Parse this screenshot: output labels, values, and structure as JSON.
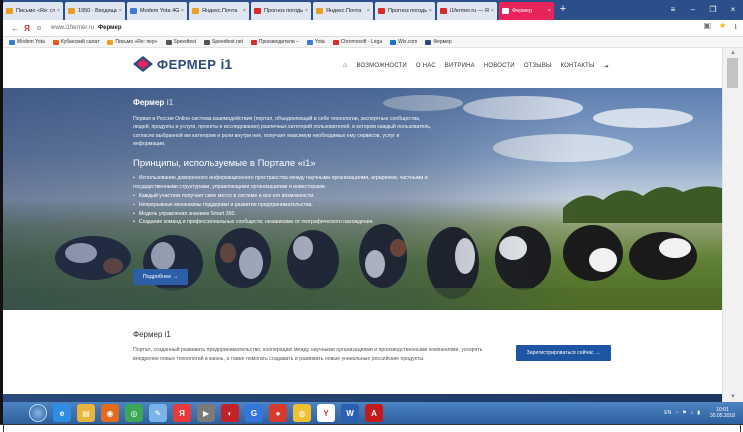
{
  "tabs": [
    {
      "label": "Письмо «Re: стат",
      "color": "#e8a020"
    },
    {
      "label": "1950 · Входящие –",
      "color": "#e8a020"
    },
    {
      "label": "Modem Yota 4G LTE",
      "color": "#3a7ad8"
    },
    {
      "label": "Яндекс.Почта",
      "color": "#e8a020"
    },
    {
      "label": "Прогноз погоды в",
      "color": "#d82a2a"
    },
    {
      "label": "Яндекс.Почта",
      "color": "#e8a020"
    },
    {
      "label": "Прогноз погоды в",
      "color": "#d82a2a"
    },
    {
      "label": "i1fermer.ru — Янд",
      "color": "#d82a2a"
    }
  ],
  "active_tab": {
    "label": "Фермер",
    "close": "×"
  },
  "new_tab": "+",
  "window_controls": {
    "menu": "≡",
    "minimize": "–",
    "restore": "❐",
    "close": "×"
  },
  "address": {
    "domain": "www.i1fermer.ru",
    "title": "Фермер"
  },
  "bookmarks": [
    {
      "label": "Modem Yota",
      "color": "#3a7ad8"
    },
    {
      "label": "Кубанский салат",
      "color": "#e85a20"
    },
    {
      "label": "Письмо «Re: пер»",
      "color": "#e8a020"
    },
    {
      "label": "Speedtest",
      "color": "#555555"
    },
    {
      "label": "Speedtest.net",
      "color": "#555555"
    },
    {
      "label": "Производители –",
      "color": "#d82a2a"
    },
    {
      "label": "Yota",
      "color": "#3a7ad8"
    },
    {
      "label": "Chromosoft - Lega",
      "color": "#d82a2a"
    },
    {
      "label": "Wix.com",
      "color": "#1a73d8"
    },
    {
      "label": "Фермер",
      "color": "#2a4a7d"
    }
  ],
  "site": {
    "logo_text": "ФЕРМЕР",
    "logo_suffix": "i1",
    "menu": [
      "ВОЗМОЖНОСТИ",
      "О НАС",
      "ВИТРИНА",
      "НОВОСТИ",
      "ОТЗЫВЫ",
      "КОНТАКТЫ"
    ]
  },
  "hero": {
    "title": "Фермер",
    "title_suffix": "i1",
    "description": "Первая в России Online-система взаимодействия (портал, объединяющий в себе технологии, экспертные сообщества, людей, продукты и услуги, проекты и исследования) различных категорий пользователей, в котором каждый пользователь, согласно выбранной им категории и роли внутри нее, получает максимум необходимых ему сервисов, услуг и информации.",
    "subtitle": "Принципы, используемые в Портале «i1»",
    "principles": [
      "Использование доверенного информационного пространства между научными организациями, аграриями, частными и государственными структурами, управляющими организациями и инвесторами.",
      "Каждый участник получает свое место в системе и все его возможности.",
      "Непрерывные механизмы поддержки и развития предпринимательства.",
      "Модель управления знанием Smart 360.",
      "Создание команд и профессиональных сообществ, независимо от географического нахождения."
    ],
    "button": "Подробнее →"
  },
  "info": {
    "title": "Фермер i1",
    "text": "Портал, созданный развивать предпринимательство, кооперацию между научными организациями и производственными компаниями, ускорять внедрение новых технологий в жизнь, а также помогать создавать и развивать новые уникальные российские продукты.",
    "button": "Зарегистрироваться сейчас →"
  },
  "taskbar": {
    "apps": [
      {
        "name": "ie",
        "color": "#2f8de4",
        "glyph": "e"
      },
      {
        "name": "folder",
        "color": "#e9b43b",
        "glyph": "▤"
      },
      {
        "name": "app",
        "color": "#e36b1e",
        "glyph": "◉"
      },
      {
        "name": "chrome",
        "color": "#3aa757",
        "glyph": "◎"
      },
      {
        "name": "paint",
        "color": "#7bb3e8",
        "glyph": "✎"
      },
      {
        "name": "yandex",
        "color": "#e83a3a",
        "glyph": "Я"
      },
      {
        "name": "player",
        "color": "#7a7a7a",
        "glyph": "▶"
      },
      {
        "name": "opera",
        "color": "#c4202a",
        "glyph": "◐"
      },
      {
        "name": "google",
        "color": "#3377dd",
        "glyph": "G"
      },
      {
        "name": "record",
        "color": "#d83a2a",
        "glyph": "●"
      },
      {
        "name": "browser",
        "color": "#f0c030",
        "glyph": "◍"
      },
      {
        "name": "yabrowser",
        "color": "#ffffff",
        "glyph": "Y"
      },
      {
        "name": "word",
        "color": "#2b5fb0",
        "glyph": "W"
      },
      {
        "name": "acrobat",
        "color": "#c41a1a",
        "glyph": "A"
      }
    ],
    "lang": "EN",
    "time": "10:01",
    "date": "30.05.2018"
  }
}
